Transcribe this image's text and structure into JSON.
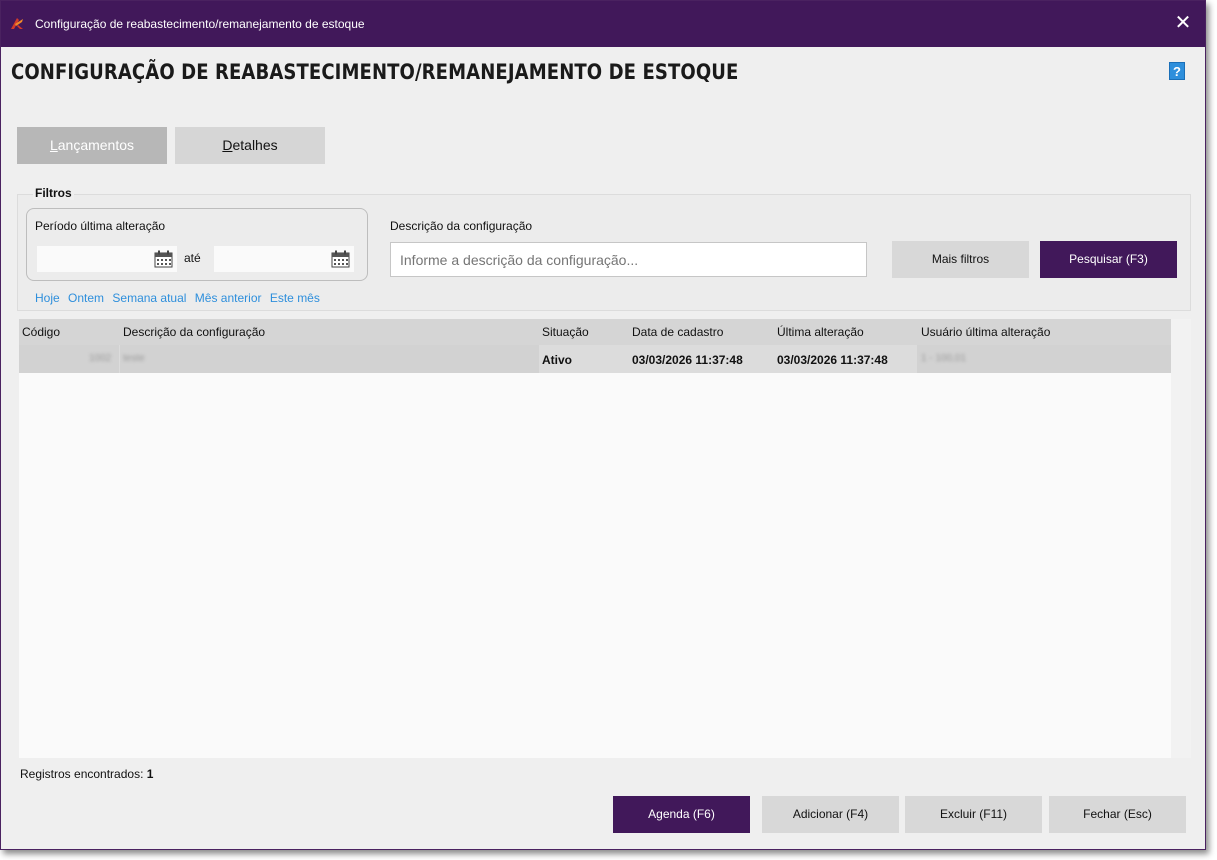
{
  "window": {
    "title": "Configuração de reabastecimento/remanejamento de estoque",
    "close_glyph": "✕"
  },
  "page": {
    "heading": "CONFIGURAÇÃO DE REABASTECIMENTO/REMANEJAMENTO DE ESTOQUE",
    "help_glyph": "?"
  },
  "tabs": [
    {
      "label_pre": "",
      "label_ul": "L",
      "label_post": "ançamentos",
      "active": true
    },
    {
      "label_pre": "",
      "label_ul": "D",
      "label_post": "etalhes",
      "active": false
    }
  ],
  "filters": {
    "legend": "Filtros",
    "period_label": "Período última alteração",
    "date_from": "",
    "date_to": "",
    "until_label": "até",
    "quick_links": [
      "Hoje",
      "Ontem",
      "Semana atual",
      "Mês anterior",
      "Este mês"
    ],
    "description_label": "Descrição da configuração",
    "description_value": "",
    "description_placeholder": "Informe a descrição da configuração...",
    "more_filters_label": "Mais filtros",
    "search_label": "Pesquisar (F3)"
  },
  "grid": {
    "columns": [
      "Código",
      "Descrição da configuração",
      "Situação",
      "Data de cadastro",
      "Última alteração",
      "Usuário última alteração"
    ],
    "rows": [
      {
        "codigo": "1002",
        "descricao": "teste",
        "situacao": "Ativo",
        "data_cadastro": "03/03/2026 11:37:48",
        "ultima_alteracao": "03/03/2026 11:37:48",
        "usuario": "1 - 100,01"
      }
    ]
  },
  "footer": {
    "records_label": "Registros encontrados:",
    "records_count": "1",
    "agenda_label": "Agenda (F6)",
    "add_label": "Adicionar (F4)",
    "delete_label": "Excluir (F11)",
    "close_label": "Fechar (Esc)"
  },
  "colors": {
    "brand_purple": "#41185a",
    "link_blue": "#2e8fdc",
    "app_icon_red": "#d23a2a"
  },
  "icons": {
    "app": "app-logo-icon",
    "close": "close-icon",
    "help": "help-icon",
    "calendar": "calendar-icon"
  }
}
